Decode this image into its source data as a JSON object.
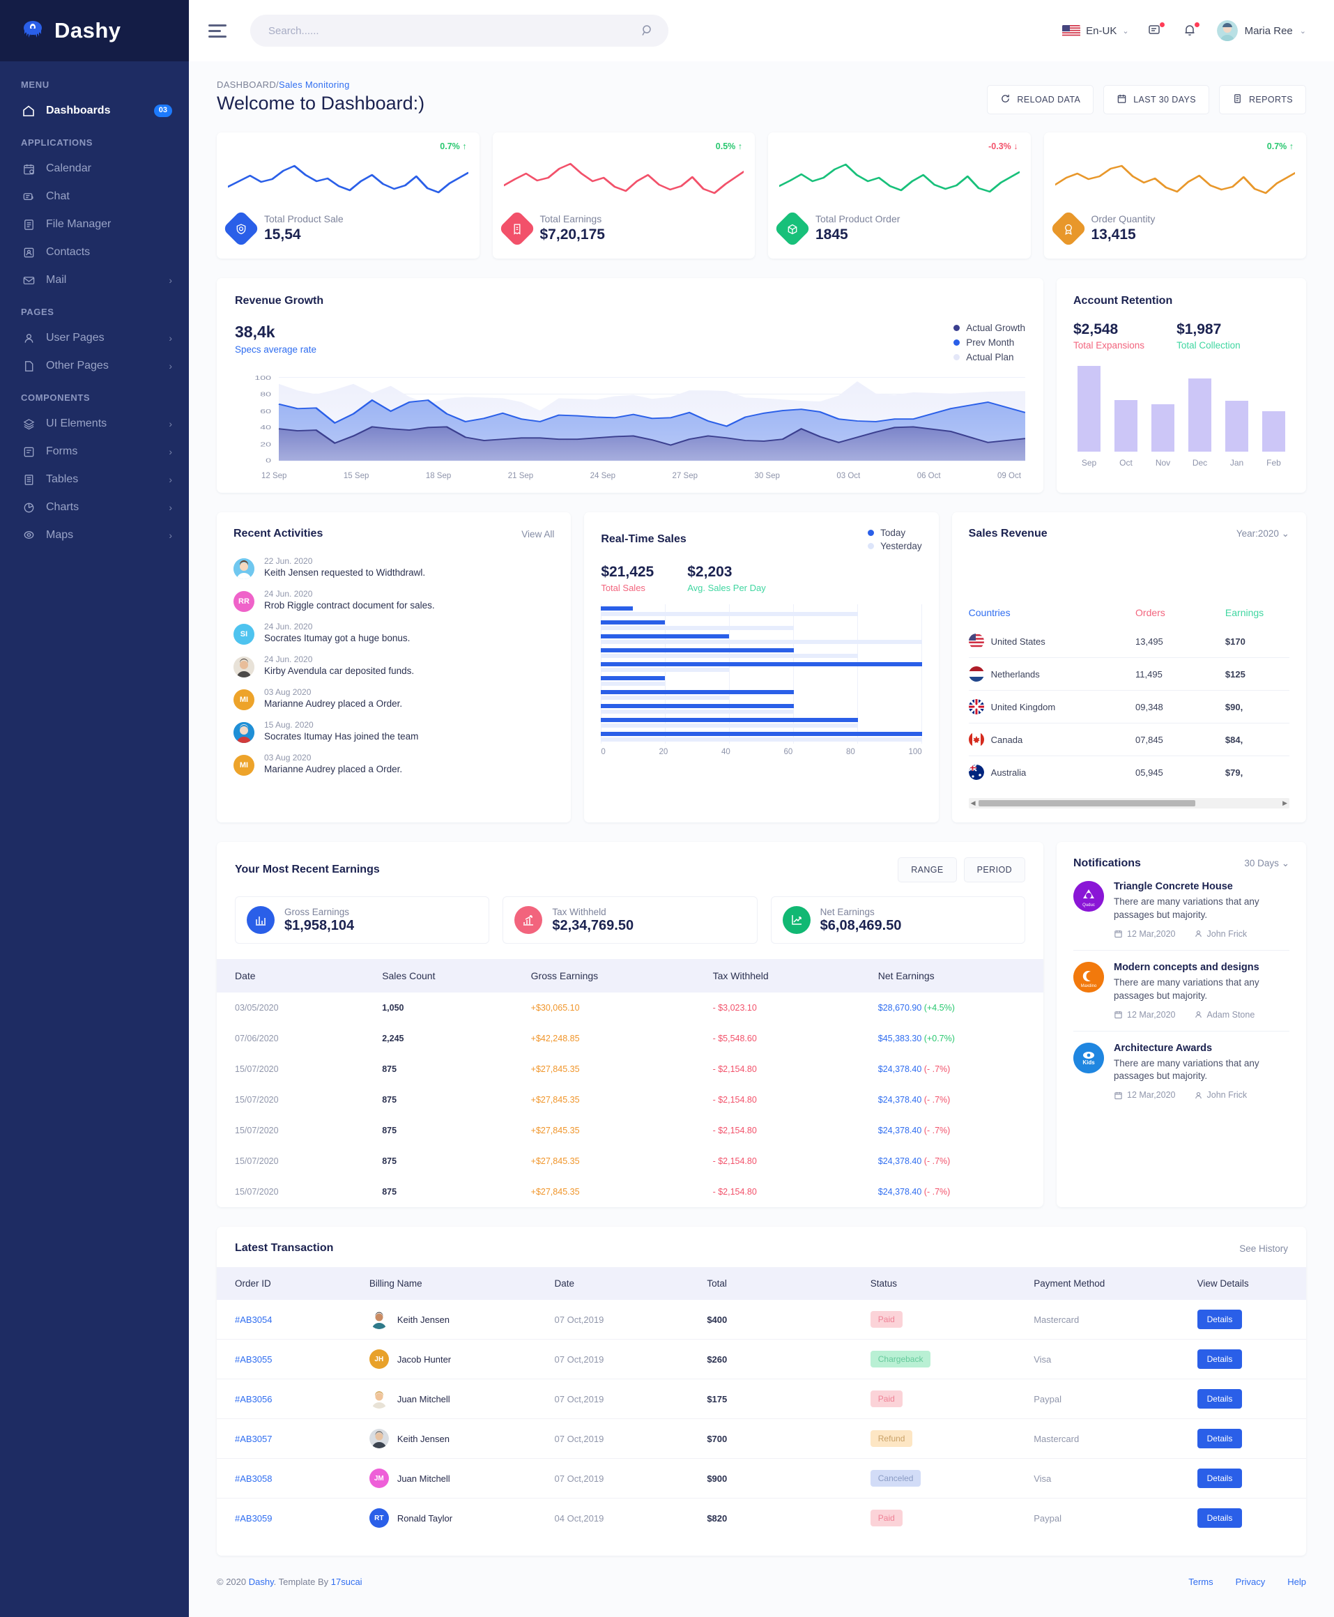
{
  "brand": {
    "name": "Dashy"
  },
  "sidebar": {
    "sections": [
      {
        "title": "MENU",
        "items": [
          {
            "label": "Dashboards",
            "icon": "home-icon",
            "badge": "03",
            "active": true
          }
        ]
      },
      {
        "title": "APPLICATIONS",
        "items": [
          {
            "label": "Calendar",
            "icon": "calendar-icon"
          },
          {
            "label": "Chat",
            "icon": "chat-icon"
          },
          {
            "label": "File Manager",
            "icon": "file-icon"
          },
          {
            "label": "Contacts",
            "icon": "contacts-icon"
          },
          {
            "label": "Mail",
            "icon": "mail-icon",
            "chevron": true
          }
        ]
      },
      {
        "title": "PAGES",
        "items": [
          {
            "label": "User Pages",
            "icon": "user-icon",
            "chevron": true
          },
          {
            "label": "Other Pages",
            "icon": "page-icon",
            "chevron": true
          }
        ]
      },
      {
        "title": "COMPONENTS",
        "items": [
          {
            "label": "UI Elements",
            "icon": "layers-icon",
            "chevron": true
          },
          {
            "label": "Forms",
            "icon": "form-icon",
            "chevron": true
          },
          {
            "label": "Tables",
            "icon": "table-icon",
            "chevron": true
          },
          {
            "label": "Charts",
            "icon": "chart-icon",
            "chevron": true
          },
          {
            "label": "Maps",
            "icon": "map-pin-icon",
            "chevron": true
          }
        ]
      }
    ]
  },
  "topbar": {
    "search_placeholder": "Search......",
    "language": "En-UK",
    "user_name": "Maria Ree"
  },
  "page": {
    "breadcrumb_root": "DASHBOARD/",
    "breadcrumb_sub": "Sales Monitoring",
    "title": "Welcome to Dashboard:)",
    "actions": [
      {
        "label": "RELOAD DATA",
        "icon": "reload-icon"
      },
      {
        "label": "LAST 30 DAYS",
        "icon": "calendar-icon"
      },
      {
        "label": "REPORTS",
        "icon": "report-icon"
      }
    ]
  },
  "stats": [
    {
      "label": "Total Product Sale",
      "value": "15,54",
      "trend": "0.7%",
      "dir": "up",
      "color": "#2a5fe8",
      "icon": "shield-check-icon"
    },
    {
      "label": "Total Earnings",
      "value": "$7,20,175",
      "trend": "0.5%",
      "dir": "up",
      "color": "#f2516a",
      "icon": "receipt-icon"
    },
    {
      "label": "Total Product Order",
      "value": "1845",
      "trend": "-0.3%",
      "dir": "down",
      "color": "#18c07a",
      "icon": "package-icon"
    },
    {
      "label": "Order Quantity",
      "value": "13,415",
      "trend": "0.7%",
      "dir": "up",
      "color": "#e8972a",
      "icon": "award-icon"
    }
  ],
  "revenue": {
    "title": "Revenue Growth",
    "big": "38,4k",
    "sub": "Specs average rate",
    "legend": [
      {
        "label": "Actual Growth",
        "color": "#3b3f8f"
      },
      {
        "label": "Prev Month",
        "color": "#2a5fe8"
      },
      {
        "label": "Actual Plan",
        "color": "#e4e7f8"
      }
    ]
  },
  "retention": {
    "title": "Account Retention",
    "expansions_value": "$2,548",
    "expansions_label": "Total Expansions",
    "collection_value": "$1,987",
    "collection_label": "Total Collection"
  },
  "activities": {
    "title": "Recent Activities",
    "view_all": "View All",
    "items": [
      {
        "date": "22 Jun. 2020",
        "text": "Keith Jensen requested to Widthdrawl.",
        "initials": "",
        "color": "#6fc7ef",
        "photo": true
      },
      {
        "date": "24 Jun. 2020",
        "text": "Rrob Riggle contract document for sales.",
        "initials": "RR",
        "color": "#ef62c9"
      },
      {
        "date": "24 Jun. 2020",
        "text": "Socrates Itumay got a huge bonus.",
        "initials": "SI",
        "color": "#4ec3ef"
      },
      {
        "date": "24 Jun. 2020",
        "text": "Kirby Avendula car deposited funds.",
        "initials": "",
        "color": "#e8e2d8",
        "photo": true
      },
      {
        "date": "03 Aug 2020",
        "text": "Marianne Audrey placed a Order.",
        "initials": "MI",
        "color": "#eda32a"
      },
      {
        "date": "15 Aug. 2020",
        "text": "Socrates Itumay Has joined the team",
        "initials": "",
        "color": "#1f8fd6",
        "photo": true
      },
      {
        "date": "03 Aug 2020",
        "text": "Marianne Audrey placed a Order.",
        "initials": "MI",
        "color": "#eda32a"
      }
    ]
  },
  "realtime": {
    "title": "Real-Time Sales",
    "legend": [
      {
        "label": "Today",
        "color": "#2a5fe8"
      },
      {
        "label": "Yesterday",
        "color": "#dde5fa"
      }
    ],
    "total_value": "$21,425",
    "total_label": "Total Sales",
    "avg_value": "$2,203",
    "avg_label": "Avg. Sales Per Day"
  },
  "sales_revenue": {
    "title": "Sales Revenue",
    "filter": "Year:2020",
    "columns": [
      "Countries",
      "Orders",
      "Earnings"
    ],
    "rows": [
      {
        "country": "United States",
        "flag": "us",
        "orders": "13,495",
        "earnings": "$170"
      },
      {
        "country": "Netherlands",
        "flag": "nl",
        "orders": "11,495",
        "earnings": "$125"
      },
      {
        "country": "United Kingdom",
        "flag": "uk",
        "orders": "09,348",
        "earnings": "$90,"
      },
      {
        "country": "Canada",
        "flag": "ca",
        "orders": "07,845",
        "earnings": "$84,"
      },
      {
        "country": "Australia",
        "flag": "au",
        "orders": "05,945",
        "earnings": "$79,"
      }
    ]
  },
  "earnings": {
    "title": "Your Most Recent Earnings",
    "buttons": [
      "RANGE",
      "PERIOD"
    ],
    "summary": [
      {
        "label": "Gross Earnings",
        "value": "$1,958,104",
        "color": "#2a5fe8",
        "icon": "bar-chart-icon"
      },
      {
        "label": "Tax Withheld",
        "value": "$2,34,769.50",
        "color": "#f2647d",
        "icon": "trend-bar-icon"
      },
      {
        "label": "Net Earnings",
        "value": "$6,08,469.50",
        "color": "#11b873",
        "icon": "trend-line-icon"
      }
    ],
    "columns": [
      "Date",
      "Sales Count",
      "Gross Earnings",
      "Tax Withheld",
      "Net Earnings"
    ],
    "rows": [
      {
        "date": "03/05/2020",
        "count": "1,050",
        "gross": "+$30,065.10",
        "tax": "- $3,023.10",
        "net": "$28,670.90",
        "pct": "(+4.5%)",
        "pct_dir": "up"
      },
      {
        "date": "07/06/2020",
        "count": "2,245",
        "gross": "+$42,248.85",
        "tax": "- $5,548.60",
        "net": "$45,383.30",
        "pct": "(+0.7%)",
        "pct_dir": "up"
      },
      {
        "date": "15/07/2020",
        "count": "875",
        "gross": "+$27,845.35",
        "tax": "- $2,154.80",
        "net": "$24,378.40",
        "pct": "(- .7%)",
        "pct_dir": "down"
      },
      {
        "date": "15/07/2020",
        "count": "875",
        "gross": "+$27,845.35",
        "tax": "- $2,154.80",
        "net": "$24,378.40",
        "pct": "(- .7%)",
        "pct_dir": "down"
      },
      {
        "date": "15/07/2020",
        "count": "875",
        "gross": "+$27,845.35",
        "tax": "- $2,154.80",
        "net": "$24,378.40",
        "pct": "(- .7%)",
        "pct_dir": "down"
      },
      {
        "date": "15/07/2020",
        "count": "875",
        "gross": "+$27,845.35",
        "tax": "- $2,154.80",
        "net": "$24,378.40",
        "pct": "(- .7%)",
        "pct_dir": "down"
      },
      {
        "date": "15/07/2020",
        "count": "875",
        "gross": "+$27,845.35",
        "tax": "- $2,154.80",
        "net": "$24,378.40",
        "pct": "(- .7%)",
        "pct_dir": "down"
      }
    ]
  },
  "notifications": {
    "title": "Notifications",
    "filter": "30 Days",
    "items": [
      {
        "title": "Triangle Concrete House",
        "text": "There are many variations that any passages but majority.",
        "date": "12 Mar,2020",
        "author": "John Frick",
        "logo_label": "Quduc",
        "logo_color": "#8a16d6"
      },
      {
        "title": "Modern concepts and designs",
        "text": "There are many variations that any passages but majority.",
        "date": "12 Mar,2020",
        "author": "Adam Stone",
        "logo_label": "Maxdino",
        "logo_color": "#f2790c"
      },
      {
        "title": "Architecture Awards",
        "text": "There are many variations that any passages but majority.",
        "date": "12 Mar,2020",
        "author": "John Frick",
        "logo_label": "Kids",
        "logo_color": "#1f86e0"
      }
    ]
  },
  "transactions": {
    "title": "Latest Transaction",
    "see_history": "See History",
    "columns": [
      "Order ID",
      "Billing Name",
      "Date",
      "Total",
      "Status",
      "Payment Method",
      "View Details"
    ],
    "details_label": "Details",
    "rows": [
      {
        "id": "#AB3054",
        "name": "Keith Jensen",
        "initials": "",
        "av_color": "#2f7a8a",
        "photo": true,
        "date": "07 Oct,2019",
        "total": "$400",
        "status": "Paid",
        "status_bg": "#fbd3d8",
        "status_fg": "#ef8296",
        "method": "Mastercard"
      },
      {
        "id": "#AB3055",
        "name": "Jacob Hunter",
        "initials": "JH",
        "av_color": "#e8a12a",
        "date": "07 Oct,2019",
        "total": "$260",
        "status": "Chargeback",
        "status_bg": "#b9f0d4",
        "status_fg": "#64c99a",
        "method": "Visa"
      },
      {
        "id": "#AB3056",
        "name": "Juan Mitchell",
        "initials": "",
        "av_color": "#d8ae6a",
        "photo": true,
        "date": "07 Oct,2019",
        "total": "$175",
        "status": "Paid",
        "status_bg": "#fbd3d8",
        "status_fg": "#ef8296",
        "method": "Paypal"
      },
      {
        "id": "#AB3057",
        "name": "Keith Jensen",
        "initials": "",
        "av_color": "#5a6070",
        "photo": true,
        "date": "07 Oct,2019",
        "total": "$700",
        "status": "Refund",
        "status_bg": "#fde6c4",
        "status_fg": "#c9a167",
        "method": "Mastercard"
      },
      {
        "id": "#AB3058",
        "name": "Juan Mitchell",
        "initials": "JM",
        "av_color": "#ee5fd8",
        "date": "07 Oct,2019",
        "total": "$900",
        "status": "Canceled",
        "status_bg": "#d2dcf7",
        "status_fg": "#8a9bc4",
        "method": "Visa"
      },
      {
        "id": "#AB3059",
        "name": "Ronald Taylor",
        "initials": "RT",
        "av_color": "#2a5fe8",
        "date": "04 Oct,2019",
        "total": "$820",
        "status": "Paid",
        "status_bg": "#fbd3d8",
        "status_fg": "#ef8296",
        "method": "Paypal"
      }
    ]
  },
  "footer": {
    "copyright_pre": "© 2020 ",
    "brand": "Dashy",
    "copyright_mid": ". Template By ",
    "author": "17sucai",
    "links": [
      "Terms",
      "Privacy",
      "Help"
    ]
  },
  "chart_data": [
    {
      "type": "area",
      "title": "Revenue Growth",
      "xlabel": "",
      "ylabel": "",
      "ylim": [
        0,
        100
      ],
      "yticks": [
        0,
        20,
        40,
        60,
        80,
        100
      ],
      "grid": true,
      "legend_position": "top-right",
      "categories": [
        "12 Sep",
        "15 Sep",
        "18 Sep",
        "21 Sep",
        "24 Sep",
        "27 Sep",
        "30 Sep",
        "03 Oct",
        "06 Oct",
        "09 Oct"
      ],
      "series": [
        {
          "name": "Actual Plan",
          "color": "#e4e7f8",
          "values": [
            92,
            84,
            79,
            85,
            92,
            81,
            89,
            76,
            68,
            74,
            77,
            76,
            75,
            70,
            60,
            76,
            75,
            74,
            78,
            80,
            74,
            77,
            84,
            84,
            83,
            75,
            74,
            73,
            71,
            70,
            78,
            95,
            80,
            78,
            82
          ]
        },
        {
          "name": "Prev Month",
          "color": "#2a5fe8",
          "values": [
            67,
            62,
            63,
            45,
            56,
            72,
            59,
            70,
            72,
            56,
            47,
            51,
            57,
            50,
            47,
            55,
            54,
            53,
            52,
            56,
            51,
            52,
            58,
            48,
            42,
            53,
            58,
            61,
            62,
            59,
            50,
            48,
            47,
            50,
            50,
            62,
            70,
            60,
            49,
            58
          ]
        },
        {
          "name": "Actual Growth",
          "color": "#3b3f8f",
          "values": [
            38,
            36,
            37,
            21,
            30,
            41,
            38,
            37,
            40,
            41,
            28,
            24,
            26,
            27,
            27,
            26,
            26,
            27,
            29,
            30,
            25,
            19,
            26,
            30,
            27,
            24,
            23,
            26,
            38,
            29,
            22,
            28,
            34,
            40,
            41,
            40,
            35,
            22,
            24,
            27,
            26,
            23,
            29,
            36,
            42,
            35,
            27,
            30,
            33
          ]
        }
      ]
    },
    {
      "type": "bar",
      "title": "Account Retention",
      "categories": [
        "Sep",
        "Oct",
        "Nov",
        "Dec",
        "Jan",
        "Feb"
      ],
      "values": [
        100,
        60,
        55,
        85,
        59,
        47
      ],
      "color": "#ccc6f7",
      "ylim": [
        0,
        100
      ],
      "grid": false
    },
    {
      "type": "bar",
      "title": "Real-Time Sales",
      "orientation": "horizontal",
      "xlim": [
        0,
        100
      ],
      "xticks": [
        0,
        20,
        40,
        60,
        80,
        100
      ],
      "categories": [
        "1",
        "2",
        "3",
        "4",
        "5",
        "6",
        "7",
        "8",
        "9",
        "10"
      ],
      "series": [
        {
          "name": "Today",
          "color": "#2a5fe8",
          "values": [
            10,
            20,
            40,
            60,
            100,
            20,
            60,
            60,
            80,
            100
          ]
        },
        {
          "name": "Yesterday",
          "color": "#e7edfd",
          "values": [
            80,
            60,
            100,
            80,
            40,
            20,
            40,
            60,
            80,
            100
          ]
        }
      ]
    },
    {
      "type": "line",
      "title": "Stat card sparklines",
      "series": [
        {
          "name": "Total Product Sale",
          "color": "#2a5fe8",
          "values": [
            30,
            42,
            52,
            44,
            48,
            62,
            70,
            56,
            48,
            52,
            40,
            34,
            48,
            58,
            44,
            36,
            42,
            56,
            38,
            30,
            44,
            60
          ]
        },
        {
          "name": "Total Earnings",
          "color": "#f2516a",
          "values": [
            32,
            46,
            58,
            48,
            50,
            68,
            74,
            58,
            46,
            50,
            38,
            32,
            46,
            56,
            42,
            34,
            40,
            54,
            36,
            30,
            42,
            62
          ]
        },
        {
          "name": "Total Product Order",
          "color": "#18c07a",
          "values": [
            34,
            44,
            56,
            46,
            52,
            66,
            72,
            56,
            46,
            52,
            40,
            34,
            48,
            58,
            44,
            36,
            42,
            56,
            38,
            32,
            46,
            64
          ]
        },
        {
          "name": "Order Quantity",
          "color": "#e8972a",
          "values": [
            36,
            48,
            58,
            50,
            54,
            68,
            70,
            54,
            44,
            50,
            38,
            32,
            46,
            56,
            42,
            34,
            40,
            54,
            36,
            30,
            44,
            62
          ]
        }
      ]
    }
  ]
}
